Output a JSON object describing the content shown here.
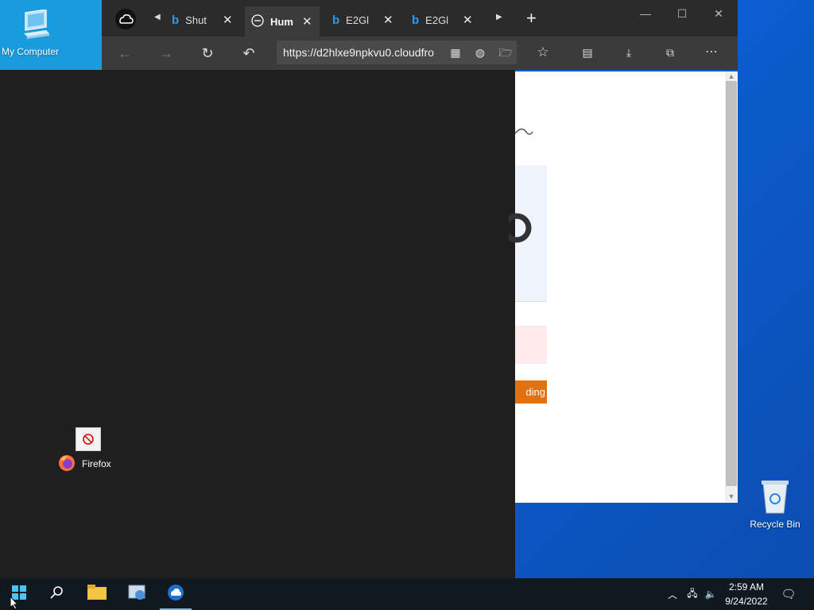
{
  "desktop": {
    "my_computer_label": "My Computer",
    "recycle_bin_label": "Recycle Bin",
    "firefox_label": "Firefox"
  },
  "browser": {
    "tabs": [
      {
        "title": "Shut",
        "icon": "bing-icon"
      },
      {
        "title": "Hum",
        "icon": "globe-icon",
        "active": true
      },
      {
        "title": "E2Gl",
        "icon": "bing-icon"
      },
      {
        "title": "E2Gl",
        "icon": "bing-icon"
      }
    ],
    "url": "https://d2hlxe9npkvu0.cloudfro"
  },
  "page": {
    "button_partial_text": "ding"
  },
  "taskbar": {
    "time": "2:59 AM",
    "date": "9/24/2022"
  },
  "colors": {
    "desktop_blue": "#0b5fd4",
    "browser_dark": "#2b2b2b",
    "accent_orange": "#e07010"
  }
}
